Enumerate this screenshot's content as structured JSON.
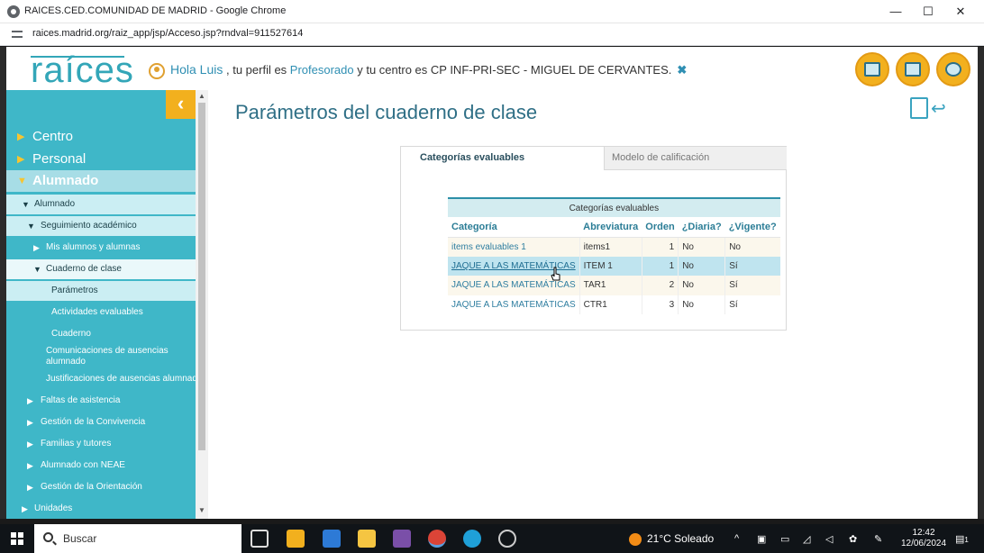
{
  "window": {
    "title": "RAICES.CED.COMUNIDAD DE MADRID - Google Chrome",
    "minimize": "—",
    "maximize": "☐",
    "close": "✕"
  },
  "browser": {
    "url": "raices.madrid.org/raiz_app/jsp/Acceso.jsp?rndval=911527614"
  },
  "header": {
    "logo": "raíces",
    "greet_hello": "Hola Luis",
    "greet_mid": " , tu perfil es ",
    "profile": "Profesorado",
    "greet_centre": " y tu centro es CP INF-PRI-SEC - MIGUEL DE CERVANTES.",
    "close_x": "✖",
    "accent": "#f2b01e"
  },
  "sidebar": {
    "collapse": "‹",
    "items": [
      {
        "label": "Centro"
      },
      {
        "label": "Personal"
      },
      {
        "label": "Alumnado"
      },
      {
        "label": "Alumnado"
      },
      {
        "label": "Seguimiento académico"
      },
      {
        "label": "Mis alumnos y alumnas"
      },
      {
        "label": "Cuaderno de clase"
      },
      {
        "label": "Parámetros"
      },
      {
        "label": "Actividades evaluables"
      },
      {
        "label": "Cuaderno"
      },
      {
        "label": "Comunicaciones de ausencias alumnado"
      },
      {
        "label": "Justificaciones de ausencias alumnado"
      },
      {
        "label": "Faltas de asistencia"
      },
      {
        "label": "Gestión de la Convivencia"
      },
      {
        "label": "Familias y tutores"
      },
      {
        "label": "Alumnado con NEAE"
      },
      {
        "label": "Gestión de la Orientación"
      },
      {
        "label": "Unidades"
      }
    ]
  },
  "main": {
    "title": "Parámetros del cuaderno de clase",
    "tabs": [
      {
        "label": "Categorías evaluables"
      },
      {
        "label": "Modelo de calificación"
      }
    ],
    "table": {
      "caption": "Categorías evaluables",
      "headers": [
        "Categoría",
        "Abreviatura",
        "Orden",
        "¿Diaria?",
        "¿Vigente?"
      ],
      "rows": [
        {
          "cat": "items evaluables 1",
          "abbr": "items1",
          "order": "1",
          "daily": "No",
          "active": "No"
        },
        {
          "cat": "JAQUE A LAS MATEMÁTICAS",
          "abbr": "ITEM 1",
          "order": "1",
          "daily": "No",
          "active": "Sí"
        },
        {
          "cat": "JAQUE A LAS MATEMÁTICAS",
          "abbr": "TAR1",
          "order": "2",
          "daily": "No",
          "active": "Sí"
        },
        {
          "cat": "JAQUE A LAS MATEMÁTICAS",
          "abbr": "CTR1",
          "order": "3",
          "daily": "No",
          "active": "Sí"
        }
      ]
    }
  },
  "taskbar": {
    "search_placeholder": "Buscar",
    "weather": "21°C  Soleado",
    "time": "12:42",
    "date": "12/06/2024",
    "notif_count": "1"
  }
}
